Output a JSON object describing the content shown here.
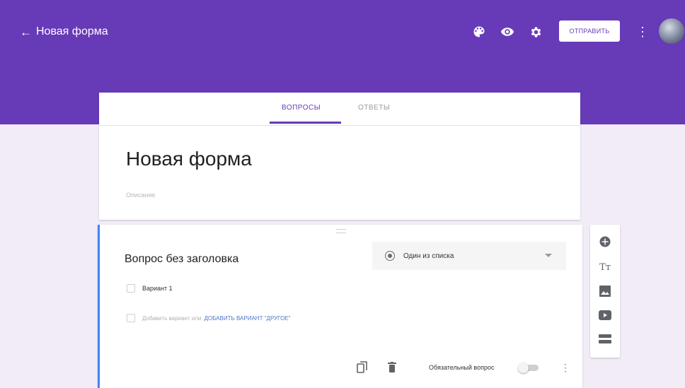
{
  "header": {
    "title": "Новая форма",
    "back_arrow": "←",
    "send_label": "ОТПРАВИТЬ",
    "icons": [
      "palette-icon",
      "eye-icon",
      "gear-icon",
      "more-vert-icon",
      "avatar"
    ],
    "accent_color": "#673ab7"
  },
  "tabs": {
    "questions": "ВОПРОСЫ",
    "answers": "ОТВЕТЫ",
    "active": "questions"
  },
  "form": {
    "title": "Новая форма",
    "description_placeholder": "Описание"
  },
  "question": {
    "title": "Вопрос без заголовка",
    "type_label": "Один из списка",
    "option_1": "Вариант 1",
    "add_option_text": "Добавить вариант или",
    "add_other_link": "ДОБАВИТЬ ВАРИАНТ \"ДРУГОЕ\"",
    "required_label": "Обязательный вопрос",
    "required": false,
    "footer_icons": [
      "copy-icon",
      "delete-icon",
      "more-vert-icon"
    ]
  },
  "side_toolbar": {
    "icons": [
      "add-question-icon",
      "title-text-icon",
      "image-icon",
      "video-icon",
      "section-icon"
    ],
    "text_icon_label": "Tт"
  }
}
